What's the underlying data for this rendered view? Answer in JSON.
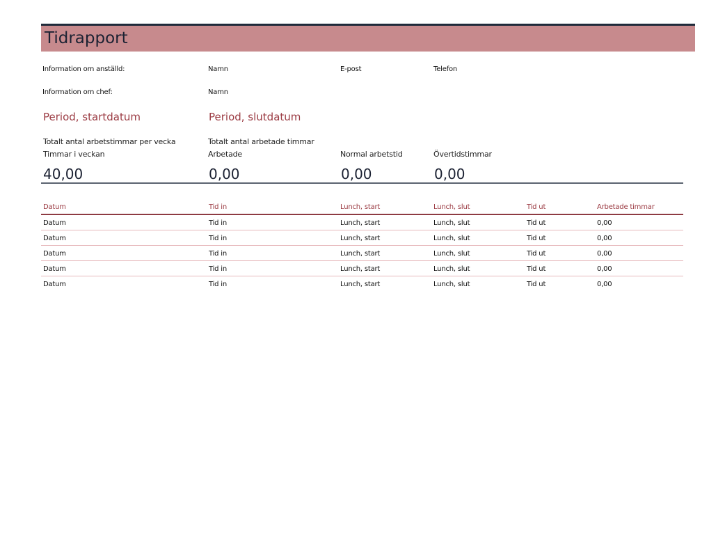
{
  "title": "Tidrapport",
  "employee": {
    "label": "Information om anställd:",
    "name": "Namn",
    "email": "E-post",
    "phone": "Telefon"
  },
  "manager": {
    "label": "Information om chef:",
    "name": "Namn"
  },
  "period": {
    "start": "Period, startdatum",
    "end": "Period, slutdatum"
  },
  "summary": {
    "weekly_hours_label_1": "Totalt antal arbetstimmar per vecka",
    "weekly_hours_label_2": "Timmar i veckan",
    "weekly_hours_value": "40,00",
    "worked_label_1": "Totalt antal arbetade timmar",
    "worked_label_2": "Arbetade",
    "worked_value": "0,00",
    "normal_label": "Normal arbetstid",
    "normal_value": "0,00",
    "overtime_label": "Övertidstimmar",
    "overtime_value": "0,00"
  },
  "table": {
    "headers": [
      "Datum",
      "Tid in",
      "Lunch, start",
      "Lunch, slut",
      "Tid ut",
      "Arbetade timmar"
    ],
    "rows": [
      [
        "Datum",
        "Tid in",
        "Lunch, start",
        "Lunch, slut",
        "Tid ut",
        "0,00"
      ],
      [
        "Datum",
        "Tid in",
        "Lunch, start",
        "Lunch, slut",
        "Tid ut",
        "0,00"
      ],
      [
        "Datum",
        "Tid in",
        "Lunch, start",
        "Lunch, slut",
        "Tid ut",
        "0,00"
      ],
      [
        "Datum",
        "Tid in",
        "Lunch, start",
        "Lunch, slut",
        "Tid ut",
        "0,00"
      ],
      [
        "Datum",
        "Tid in",
        "Lunch, start",
        "Lunch, slut",
        "Tid ut",
        "0,00"
      ]
    ]
  },
  "colors": {
    "title_bar": "#c78a8d",
    "accent": "#9b3b43",
    "row_rule": "#e6b8bb"
  }
}
